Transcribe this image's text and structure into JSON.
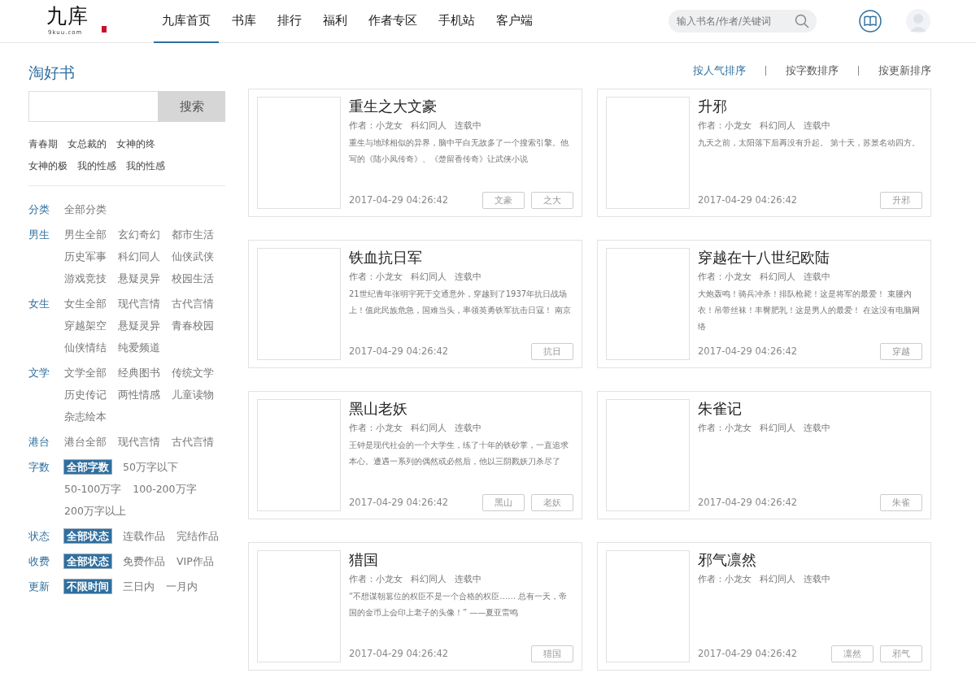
{
  "header": {
    "logo": {
      "name": "九库",
      "domain": "9kuu.com"
    },
    "nav": [
      {
        "label": "九库首页",
        "selected": true
      },
      {
        "label": "书库",
        "selected": false
      },
      {
        "label": "排行",
        "selected": false
      },
      {
        "label": "福利",
        "selected": false
      },
      {
        "label": "作者专区",
        "selected": false
      },
      {
        "label": "手机站",
        "selected": false
      },
      {
        "label": "客户端",
        "selected": false
      }
    ],
    "search": {
      "placeholder": "输入书名/作者/关键词"
    }
  },
  "sidebar": {
    "title": "淘好书",
    "search_button": "搜索",
    "hot_tags": [
      "青春期",
      "女总裁的",
      "女神的终",
      "女神的极",
      "我的性感",
      "我的性感"
    ],
    "filters": [
      {
        "label": "分类",
        "options": [
          {
            "label": "全部分类",
            "selected": false
          }
        ]
      },
      {
        "label": "男生",
        "options": [
          {
            "label": "男生全部",
            "selected": false
          },
          {
            "label": "玄幻奇幻",
            "selected": false
          },
          {
            "label": "都市生活",
            "selected": false
          },
          {
            "label": "历史军事",
            "selected": false
          },
          {
            "label": "科幻同人",
            "selected": false
          },
          {
            "label": "仙侠武侠",
            "selected": false
          },
          {
            "label": "游戏竞技",
            "selected": false
          },
          {
            "label": "悬疑灵异",
            "selected": false
          },
          {
            "label": "校园生活",
            "selected": false
          }
        ]
      },
      {
        "label": "女生",
        "options": [
          {
            "label": "女生全部",
            "selected": false
          },
          {
            "label": "现代言情",
            "selected": false
          },
          {
            "label": "古代言情",
            "selected": false
          },
          {
            "label": "穿越架空",
            "selected": false
          },
          {
            "label": "悬疑灵异",
            "selected": false
          },
          {
            "label": "青春校园",
            "selected": false
          },
          {
            "label": "仙侠情结",
            "selected": false
          },
          {
            "label": "纯爱频道",
            "selected": false
          }
        ]
      },
      {
        "label": "文学",
        "options": [
          {
            "label": "文学全部",
            "selected": false
          },
          {
            "label": "经典图书",
            "selected": false
          },
          {
            "label": "传统文学",
            "selected": false
          },
          {
            "label": "历史传记",
            "selected": false
          },
          {
            "label": "两性情感",
            "selected": false
          },
          {
            "label": "儿童读物",
            "selected": false
          },
          {
            "label": "杂志绘本",
            "selected": false
          }
        ]
      },
      {
        "label": "港台",
        "options": [
          {
            "label": "港台全部",
            "selected": false
          },
          {
            "label": "现代言情",
            "selected": false
          },
          {
            "label": "古代言情",
            "selected": false
          }
        ]
      },
      {
        "label": "字数",
        "options": [
          {
            "label": "全部字数",
            "selected": true
          },
          {
            "label": "50万字以下",
            "selected": false
          },
          {
            "label": "50-100万字",
            "selected": false
          },
          {
            "label": "100-200万字",
            "selected": false
          },
          {
            "label": "200万字以上",
            "selected": false
          }
        ]
      },
      {
        "label": "状态",
        "options": [
          {
            "label": "全部状态",
            "selected": true
          },
          {
            "label": "连载作品",
            "selected": false
          },
          {
            "label": "完结作品",
            "selected": false
          }
        ]
      },
      {
        "label": "收费",
        "options": [
          {
            "label": "全部状态",
            "selected": true
          },
          {
            "label": "免费作品",
            "selected": false
          },
          {
            "label": "VIP作品",
            "selected": false
          }
        ]
      },
      {
        "label": "更新",
        "options": [
          {
            "label": "不限时间",
            "selected": true
          },
          {
            "label": "三日内",
            "selected": false
          },
          {
            "label": "一月内",
            "selected": false
          }
        ]
      }
    ]
  },
  "sort": [
    {
      "label": "按人气排序",
      "selected": true
    },
    {
      "label": "按字数排序",
      "selected": false
    },
    {
      "label": "按更新排序",
      "selected": false
    }
  ],
  "books": [
    {
      "title": "重生之大文豪",
      "author": "作者：小龙女",
      "genre": "科幻同人",
      "status": "连载中",
      "summary": "重生与地球相似的异界，脑中平白无故多了一个搜索引擎。他写的《陆小凤传奇》、《楚留香传奇》让武侠小说",
      "date": "2017-04-29 04:26:42",
      "tags": [
        "文豪",
        "之大"
      ]
    },
    {
      "title": "升邪",
      "author": "作者：小龙女",
      "genre": "科幻同人",
      "status": "连载中",
      "summary": "九天之前，太阳落下后再没有升起。 第十天，苏景名动四方。",
      "date": "2017-04-29 04:26:42",
      "tags": [
        "升邪"
      ]
    },
    {
      "title": "铁血抗日军",
      "author": "作者：小龙女",
      "genre": "科幻同人",
      "status": "连载中",
      "summary": "21世纪青年张明宇死于交通意外，穿越到了1937年抗日战场上！值此民族危急，国难当头，率领英勇铁军抗击日寇！ 南京",
      "date": "2017-04-29 04:26:42",
      "tags": [
        "抗日"
      ]
    },
    {
      "title": "穿越在十八世纪欧陆",
      "author": "作者：小龙女",
      "genre": "科幻同人",
      "status": "连载中",
      "summary": "大炮轰鸣！骑兵冲杀！排队枪毙！这是将军的最爱！ 束腰内衣！吊带丝袜！丰臀肥乳！这是男人的最爱！ 在这没有电脑网络",
      "date": "2017-04-29 04:26:42",
      "tags": [
        "穿越"
      ]
    },
    {
      "title": "黑山老妖",
      "author": "作者：小龙女",
      "genre": "科幻同人",
      "status": "连载中",
      "summary": "王钟是现代社会的一个大学生，练了十年的铁砂掌，一直追求本心。遭遇一系列的偶然或必然后，他以三阴戮妖刀杀尽了",
      "date": "2017-04-29 04:26:42",
      "tags": [
        "黑山",
        "老妖"
      ]
    },
    {
      "title": "朱雀记",
      "author": "作者：小龙女",
      "genre": "科幻同人",
      "status": "连载中",
      "date": "2017-04-29 04:26:42",
      "tags": [
        "朱雀"
      ]
    },
    {
      "title": "猎国",
      "author": "作者：小龙女",
      "genre": "科幻同人",
      "status": "连载中",
      "summary": "“不想谋朝篡位的权臣不是一个合格的权臣…… 总有一天，帝国的金币上会印上老子的头像！” ——夏亚雷鸣",
      "date": "2017-04-29 04:26:42",
      "tags": [
        "猎国"
      ]
    },
    {
      "title": "邪气凛然",
      "author": "作者：小龙女",
      "genre": "科幻同人",
      "status": "连载中",
      "date": "2017-04-29 04:26:42",
      "tags": [
        "凛然",
        "邪气"
      ]
    }
  ]
}
